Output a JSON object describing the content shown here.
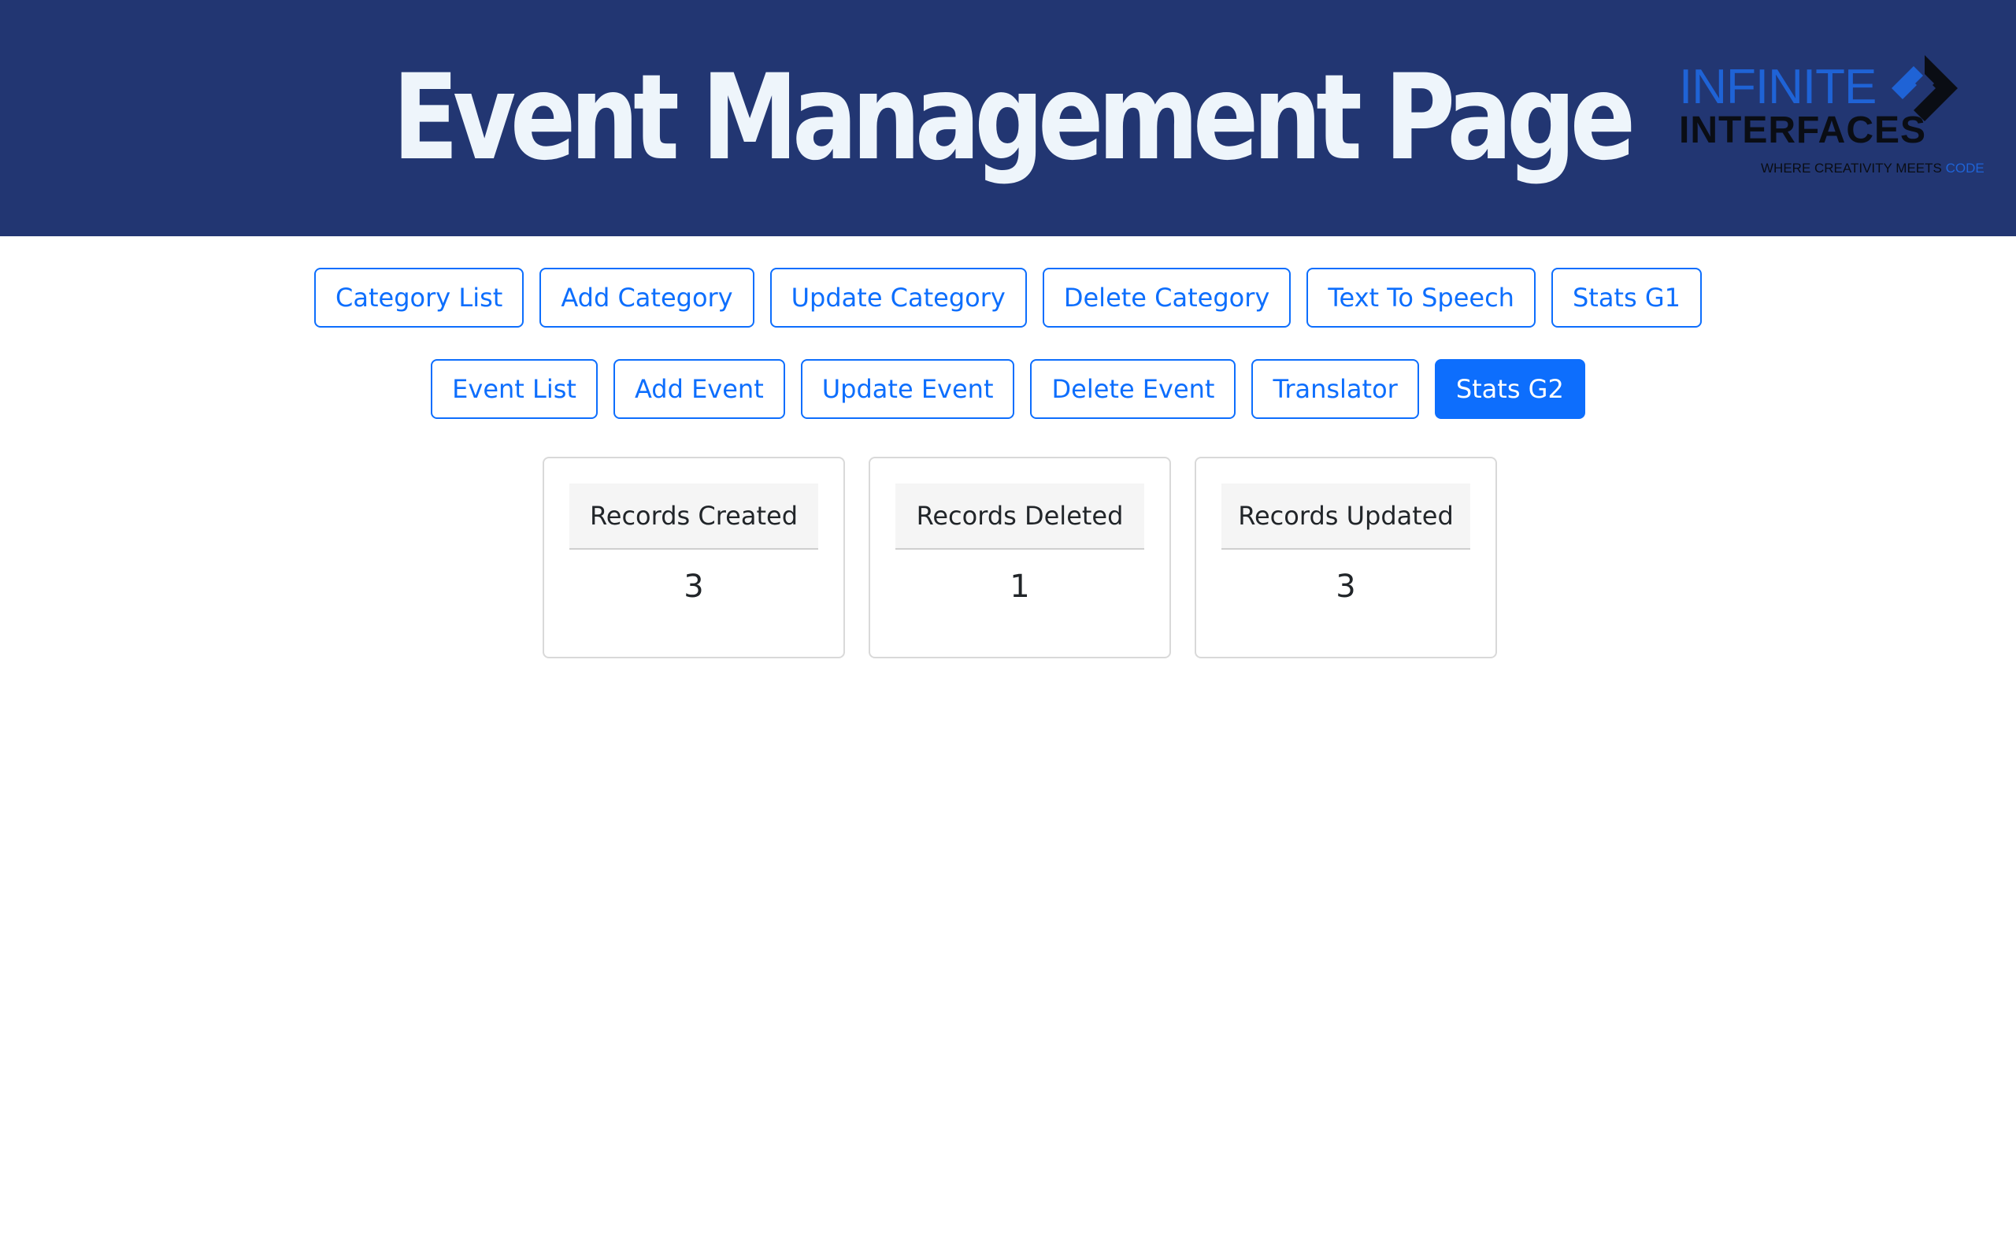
{
  "header": {
    "title": "Event Management Page",
    "background_color": "#223672",
    "logo": {
      "line1": "INFINITE",
      "line2": "INTERFACES",
      "tagline": "WHERE CREATIVITY MEETS",
      "tagline_accent": "CODE",
      "mark_icon": "diamond-arrow-logo-icon"
    }
  },
  "nav": {
    "accent_color": "#0d6efd",
    "row1": [
      {
        "label": "Category List",
        "active": false
      },
      {
        "label": "Add Category",
        "active": false
      },
      {
        "label": "Update Category",
        "active": false
      },
      {
        "label": "Delete Category",
        "active": false
      },
      {
        "label": "Text To Speech",
        "active": false
      },
      {
        "label": "Stats G1",
        "active": false
      }
    ],
    "row2": [
      {
        "label": "Event List",
        "active": false
      },
      {
        "label": "Add Event",
        "active": false
      },
      {
        "label": "Update Event",
        "active": false
      },
      {
        "label": "Delete Event",
        "active": false
      },
      {
        "label": "Translator",
        "active": false
      },
      {
        "label": "Stats G2",
        "active": true
      }
    ]
  },
  "stats": [
    {
      "label": "Records Created",
      "value": "3"
    },
    {
      "label": "Records Deleted",
      "value": "1"
    },
    {
      "label": "Records Updated",
      "value": "3"
    }
  ]
}
